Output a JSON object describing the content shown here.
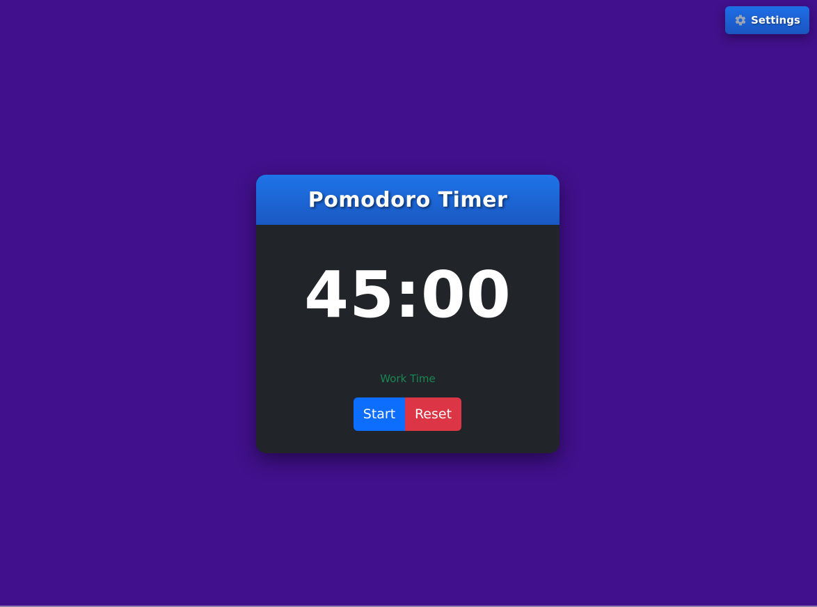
{
  "settings_button": {
    "label": "Settings",
    "icon": "gear-icon"
  },
  "timer_card": {
    "title": "Pomodoro Timer",
    "time_display": "45:00",
    "mode_label": "Work Time",
    "start_label": "Start",
    "reset_label": "Reset"
  },
  "colors": {
    "background": "#41108c",
    "header_blue": "#1a6be0",
    "card_bg": "#212529",
    "start_button": "#0d6efd",
    "reset_button": "#dc3545",
    "mode_text": "#198754"
  }
}
